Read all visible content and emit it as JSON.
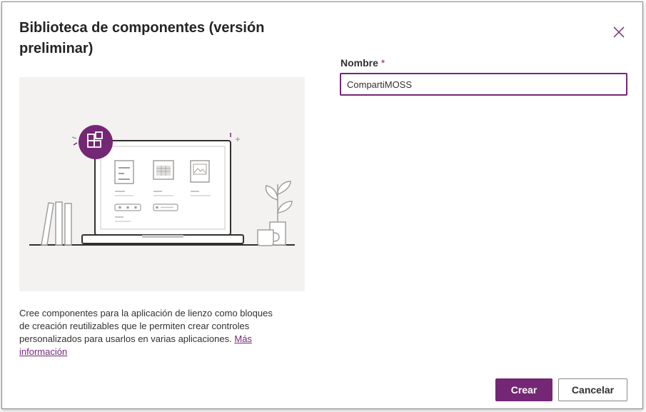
{
  "dialog": {
    "title": "Biblioteca de componentes (versión preliminar)",
    "description": "Cree componentes para la aplicación de lienzo como bloques de creación reutilizables que le permiten crear controles personalizados para usarlos en varias aplicaciones.",
    "more_info_link": "Más información",
    "close_icon": "close-icon",
    "illustration_icon": "component-library-icon"
  },
  "form": {
    "name_label": "Nombre",
    "required_mark": "*",
    "name_value": "CompartiMOSS"
  },
  "buttons": {
    "create_label": "Crear",
    "cancel_label": "Cancelar"
  },
  "colors": {
    "accent": "#742774",
    "illustration_bg": "#f3f2f1",
    "required": "#a4262c"
  }
}
